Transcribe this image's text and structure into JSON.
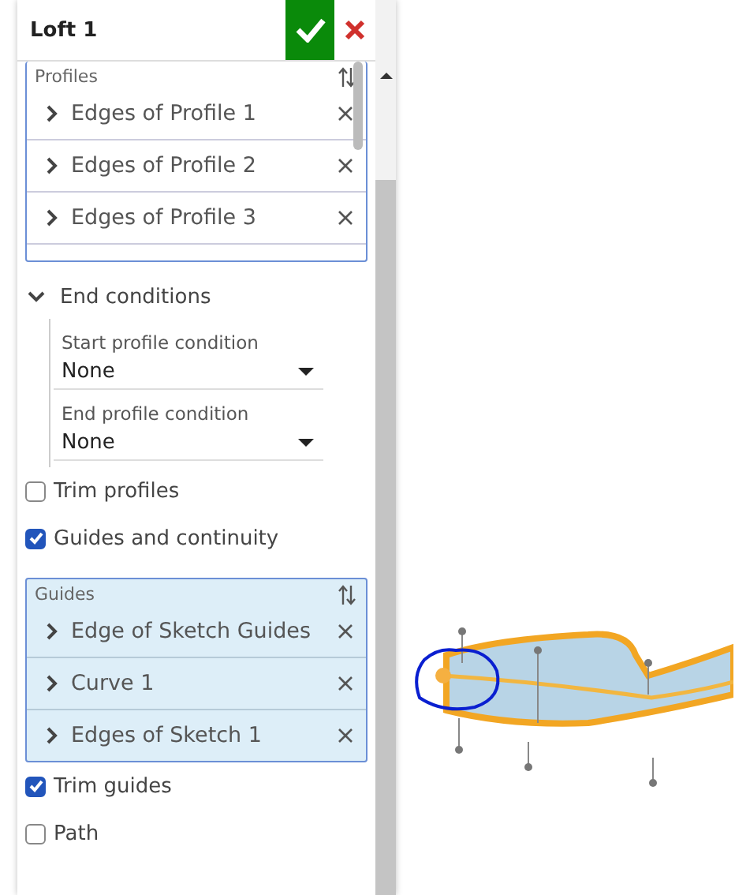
{
  "panel": {
    "title": "Loft 1",
    "profiles": {
      "label": "Profiles",
      "items": [
        {
          "label": "Edges of Profile 1"
        },
        {
          "label": "Edges of Profile 2"
        },
        {
          "label": "Edges of Profile 3"
        }
      ]
    },
    "end_conditions": {
      "label": "End conditions",
      "expanded": true,
      "fields": [
        {
          "label": "Start profile condition",
          "value": "None"
        },
        {
          "label": "End profile condition",
          "value": "None"
        }
      ]
    },
    "options_a": [
      {
        "label": "Trim profiles",
        "checked": false
      },
      {
        "label": "Guides and continuity",
        "checked": true
      }
    ],
    "guides": {
      "label": "Guides",
      "items": [
        {
          "label": "Edge of Sketch Guides"
        },
        {
          "label": "Curve 1"
        },
        {
          "label": "Edges of Sketch 1"
        }
      ]
    },
    "options_b": [
      {
        "label": "Trim guides",
        "checked": true
      },
      {
        "label": "Path",
        "checked": false
      }
    ]
  }
}
